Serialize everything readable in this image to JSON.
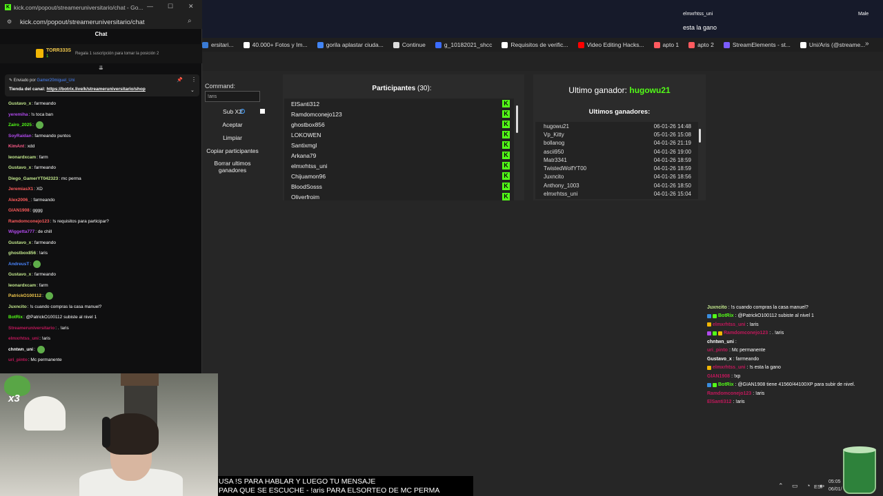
{
  "colors": {
    "kick_green": "#53fc18",
    "panel": "#2b2b2b",
    "bg": "#262626"
  },
  "bookmarks": [
    {
      "label": "ersitari...",
      "color": "#3a7bd5"
    },
    {
      "label": "40.000+ Fotos y Im...",
      "color": "#ffffff"
    },
    {
      "label": "gorila aplastar ciuda...",
      "color": "#4285f4"
    },
    {
      "label": "Continue",
      "color": "#dddddd"
    },
    {
      "label": "g_10182021_shcc",
      "color": "#3b6cff"
    },
    {
      "label": "Requisitos de verific...",
      "color": "#ffffff"
    },
    {
      "label": "Video Editing Hacks...",
      "color": "#ff0000"
    },
    {
      "label": "apto 1",
      "color": "#ff5a5f"
    },
    {
      "label": "apto 2",
      "color": "#ff5a5f"
    },
    {
      "label": "StreamElements - st...",
      "color": "#7b5cff"
    },
    {
      "label": "Uni/Aris (@streame...",
      "color": "#ffffff"
    }
  ],
  "bookmarks_overflow": "»",
  "top_overlay": {
    "user": "elmxrhtss_uni",
    "message": "esta la gano",
    "tag": "Male"
  },
  "raffle": {
    "command_label": "Command:",
    "command_value": "!aris",
    "sub_x2": "Sub X2",
    "info": "i",
    "accept": "Aceptar",
    "clear": "Limpiar",
    "copy": "Copiar participantes",
    "delete_winners": "Borrar ultimos ganadores",
    "participants_title": "Participantes",
    "participants_count": "(30):",
    "participants": [
      "ElSanti312",
      "Ramdomconejo123",
      "ghostbox856",
      "LOKOWEN",
      "Santixmgl",
      "Arkana79",
      "elmxrhtss_uni",
      "Chijuamon96",
      "BloodSosss",
      "Oliverfroim"
    ],
    "kick_badge": "K",
    "last_winner_label": "Ultimo ganador:",
    "last_winner": "hugowu21",
    "winners_title": "Ultimos ganadores:",
    "winners": [
      {
        "name": "hugowu21",
        "date": "06-01-26 14:48"
      },
      {
        "name": "Vp_Kitty",
        "date": "05-01-26 15:08"
      },
      {
        "name": "bollanog",
        "date": "04-01-26 21:19"
      },
      {
        "name": "ascii950",
        "date": "04-01-26 19:00"
      },
      {
        "name": "Matr3341",
        "date": "04-01-26 18:59"
      },
      {
        "name": "TwistedWolfYT00",
        "date": "04-01-26 18:59"
      },
      {
        "name": "Juxncito",
        "date": "04-01-26 18:56"
      },
      {
        "name": "Anthony_1003",
        "date": "04-01-26 18:50"
      },
      {
        "name": "elmxrhtss_uni",
        "date": "04-01-26 15:04"
      }
    ]
  },
  "overlay_chat": [
    {
      "user": "Juxncito",
      "color": "#c3e88d",
      "text": ": !s cuando compras la casa manuel?",
      "badges": []
    },
    {
      "user": "BotRix",
      "color": "#53fc18",
      "text": ": @PatrickO100112 subiste al nivel 1",
      "badges": [
        "#3a8dde",
        "#53fc18"
      ]
    },
    {
      "user": "elmxrhtss_uni",
      "color": "#c2185b",
      "text": ": !aris",
      "badges": [
        "#f2b705"
      ]
    },
    {
      "user": "Ramdomconejo123",
      "color": "#c2185b",
      "text": ": . !aris",
      "badges": [
        "#b14aed",
        "#53fc18",
        "#f2b705"
      ]
    },
    {
      "user": "chntwn_uni",
      "color": "#ffffff",
      "text": ":",
      "badges": []
    },
    {
      "user": "uri_pinto",
      "color": "#c2185b",
      "text": ": Mc permanente",
      "badges": []
    },
    {
      "user": "Gustavo_x",
      "color": "#ffffff",
      "text": ": farmeando",
      "badges": []
    },
    {
      "user": "elmxrhtss_uni",
      "color": "#c2185b",
      "text": ": !s esta la gano",
      "badges": [
        "#f2b705"
      ]
    },
    {
      "user": "GIAN1908",
      "color": "#c2185b",
      "text": ": !xp",
      "badges": []
    },
    {
      "user": "BotRix",
      "color": "#53fc18",
      "text": ": @GIAN1908 tiene 41560/44100XP para subir de nivel.",
      "badges": [
        "#3a8dde",
        "#53fc18"
      ]
    },
    {
      "user": "Ramdomconejo123",
      "color": "#c2185b",
      "text": ": !aris",
      "badges": []
    },
    {
      "user": "ElSanti312",
      "color": "#c2185b",
      "text": ": !aris",
      "badges": []
    }
  ],
  "popup": {
    "title": "kick.com/popout/streameruniversitario/chat - Go...",
    "url": "kick.com/popout/streameruniversitario/chat",
    "chat_header": "Chat",
    "gift_user": "TORR333S",
    "gift_count": "1",
    "gift_text": "Regala 1 suscripción para tomar la posición 2",
    "pinned_by_label": "Enviado por",
    "pinned_by_user": "Gamer20miguel_Uni",
    "pinned_store_label": "Tienda del canal:",
    "pinned_link": "https://botrix.live/k/streameruniversitario/shop"
  },
  "chat": [
    {
      "user": "Gustavo_x",
      "color": "#c3e88d",
      "text": ": farmeando",
      "emote": false
    },
    {
      "user": "yeremiha",
      "color": "#b14aed",
      "text": ": !s toca ban",
      "emote": false
    },
    {
      "user": "Zairo_2025",
      "color": "#53fc18",
      "text": ":",
      "emote": true
    },
    {
      "user": "SoyRaidan",
      "color": "#b14aed",
      "text": ": farmeando puntos",
      "emote": false
    },
    {
      "user": "KimAnt",
      "color": "#ff5c8a",
      "text": ": xdd",
      "emote": false
    },
    {
      "user": "leonardxcam",
      "color": "#c3e88d",
      "text": ": farm",
      "emote": false
    },
    {
      "user": "Gustavo_x",
      "color": "#c3e88d",
      "text": ": farmeando",
      "emote": false
    },
    {
      "user": "Diego_GamerYT042323",
      "color": "#c3e88d",
      "text": ": mc perma",
      "emote": false
    },
    {
      "user": "JeremiasX1",
      "color": "#ff5c5c",
      "text": ": XD",
      "emote": false
    },
    {
      "user": "Alex2006_",
      "color": "#ff5c5c",
      "text": ": farmeando",
      "emote": false
    },
    {
      "user": "GIAN1908",
      "color": "#ff5c5c",
      "text": ": gggg",
      "emote": false
    },
    {
      "user": "Ramdomconejo123",
      "color": "#ff5c5c",
      "text": ": !s requisitos para participar?",
      "emote": false
    },
    {
      "user": "Wiggetta777",
      "color": "#b14aed",
      "text": ": de chill",
      "emote": false
    },
    {
      "user": "Gustavo_x",
      "color": "#c3e88d",
      "text": ": farmeando",
      "emote": false
    },
    {
      "user": "ghostbox856",
      "color": "#c3e88d",
      "text": ": !aris",
      "emote": false
    },
    {
      "user": "AndreusT",
      "color": "#4a86ff",
      "text": ":",
      "emote": true
    },
    {
      "user": "Gustavo_x",
      "color": "#c3e88d",
      "text": ": farmeando",
      "emote": false
    },
    {
      "user": "leonardxcam",
      "color": "#c3e88d",
      "text": ": farm",
      "emote": false
    },
    {
      "user": "PatrickO100112",
      "color": "#f2c94c",
      "text": ":",
      "emote": true
    },
    {
      "user": "Juxncito",
      "color": "#c3e88d",
      "text": ": !s cuando compras la casa manuel?",
      "emote": false
    },
    {
      "user": "BotRix",
      "color": "#53fc18",
      "text": ": @PatrickO100112 subiste al nivel 1",
      "emote": false
    },
    {
      "user": "Streameruniversitario",
      "color": "#c2185b",
      "text": ": . !aris",
      "emote": false
    },
    {
      "user": "elmxrhtss_uni",
      "color": "#c2185b",
      "text": ": !aris",
      "emote": false
    },
    {
      "user": "chntwn_uni",
      "color": "#ffffff",
      "text": ":",
      "emote": true
    },
    {
      "user": "uri_pinto",
      "color": "#c2185b",
      "text": ": Mc permanente",
      "emote": false
    }
  ],
  "webcam": {
    "overlay_text": "x3"
  },
  "caption": {
    "line1": "USA !S PARA HABLAR Y LUEGO TU MENSAJE",
    "line2": "PARA QUE SE ESCUCHE - !aris PARA ELSORTEO DE MC PERMA"
  },
  "tray": {
    "icons": "⌃ ▭ ◔ ◖",
    "lang": "ESP",
    "time": "05:05",
    "date": "06/01/"
  }
}
